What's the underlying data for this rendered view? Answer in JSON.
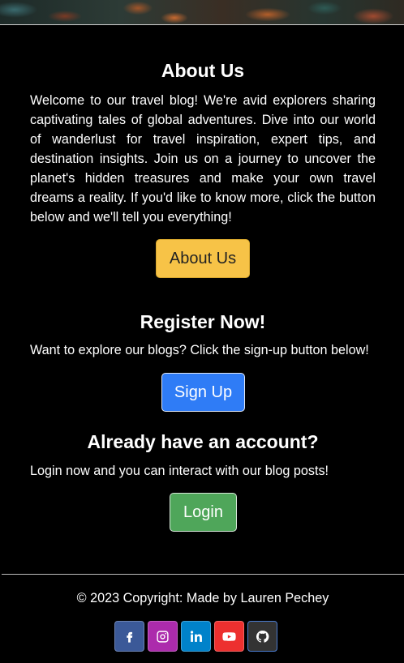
{
  "about": {
    "title": "About Us",
    "text": "Welcome to our travel blog! We're avid explorers sharing captivating tales of global adventures. Dive into our world of wanderlust for travel inspiration, expert tips, and destination insights. Join us on a journey to uncover the planet's hidden treasures and make your own travel dreams a reality. If you'd like to know more, click the button below and we'll tell you everything!",
    "button_label": "About Us"
  },
  "register": {
    "title": "Register Now!",
    "text": "Want to explore our blogs? Click the sign-up button below!",
    "button_label": "Sign Up"
  },
  "login": {
    "title": "Already have an account?",
    "text": "Login now and you can interact with our blog posts!",
    "button_label": "Login"
  },
  "footer": {
    "copyright": "© 2023 Copyright: Made by Lauren Pechey",
    "socials": [
      {
        "icon": "facebook-icon",
        "color": "#3b5998"
      },
      {
        "icon": "instagram-icon",
        "color": "#ac2bac"
      },
      {
        "icon": "linkedin-icon",
        "color": "#0082ca"
      },
      {
        "icon": "youtube-icon",
        "color": "#ed302f"
      },
      {
        "icon": "github-icon",
        "color": "#333333"
      }
    ]
  }
}
